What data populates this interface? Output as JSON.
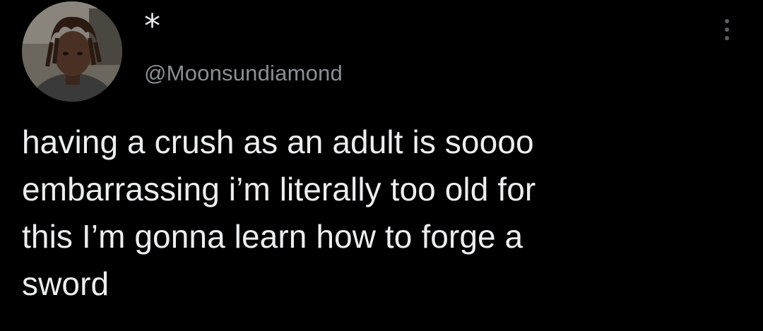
{
  "tweet": {
    "author": {
      "display_name": "*",
      "handle": "@Moonsundiamond",
      "avatar_icon": "profile-photo"
    },
    "more_icon": "more-options-icon",
    "text_lines": [
      "having a crush as an adult is soooo",
      "embarrassing i’m literally too old for",
      "this I’m gonna learn how to forge a",
      "sword"
    ]
  },
  "colors": {
    "background": "#000000",
    "text_primary": "#e7e9ea",
    "text_secondary": "#8b9096"
  }
}
